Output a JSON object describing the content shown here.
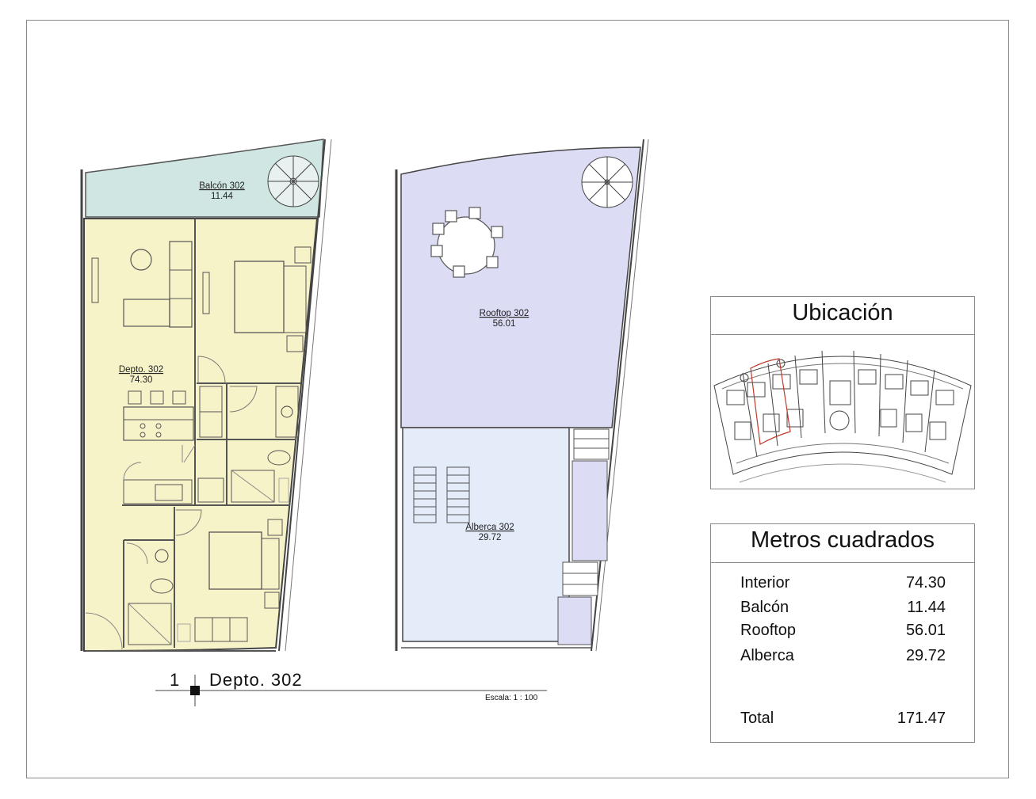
{
  "plan": {
    "balcon": {
      "name": "Balcón 302",
      "area": "11.44"
    },
    "depto": {
      "name": "Depto. 302",
      "area": "74.30"
    },
    "rooftop": {
      "name": "Rooftop 302",
      "area": "56.01"
    },
    "alberca": {
      "name": "Alberca 302",
      "area": "29.72"
    }
  },
  "view_title": {
    "number": "1",
    "name": "Depto. 302",
    "scale": "Escala: 1 : 100"
  },
  "ubicacion": {
    "title": "Ubicación"
  },
  "metros": {
    "title": "Metros cuadrados",
    "rows": [
      {
        "label": "Interior",
        "value": "74.30"
      },
      {
        "label": "Balcón",
        "value": "11.44"
      },
      {
        "label": "Rooftop",
        "value": "56.01"
      },
      {
        "label": "Alberca",
        "value": "29.72"
      }
    ],
    "total": {
      "label": "Total",
      "value": "171.47"
    }
  },
  "colors": {
    "interior": "#f7f3c8",
    "balcon": "#cfe6e2",
    "rooftop": "#dcdcf5",
    "alberca": "#e3ecf8",
    "line": "#555555"
  }
}
